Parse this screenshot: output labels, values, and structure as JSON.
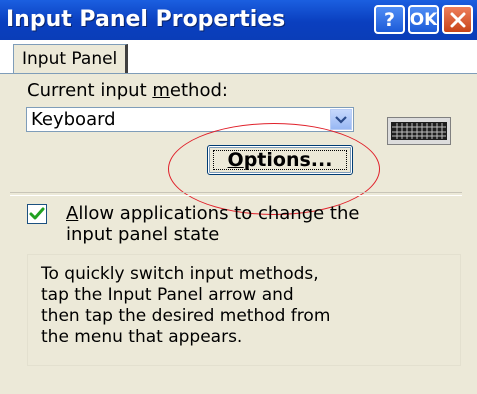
{
  "window": {
    "title": "Input Panel Properties",
    "buttons": {
      "help": "?",
      "ok": "OK",
      "close": "X"
    }
  },
  "tabs": [
    {
      "label": "Input Panel",
      "selected": true
    }
  ],
  "input_method": {
    "label_before": "Current input ",
    "label_accel": "m",
    "label_after": "ethod:",
    "selected_value": "Keyboard",
    "options_label_accel": "O",
    "options_label_rest": "ptions..."
  },
  "allow_apps": {
    "checked": true,
    "label_accel": "A",
    "label_line1_rest": "llow applications to change the",
    "label_line2": "input panel state"
  },
  "info": {
    "lines": [
      "To quickly switch input methods,",
      "tap the Input Panel arrow and",
      "then tap the desired method from",
      "the menu that appears."
    ]
  },
  "colors": {
    "title_bar": "#0a3fbf",
    "annotation_ellipse": "#e0202a",
    "check_mark": "#21a121"
  },
  "icons": {
    "keyboard": "keyboard-icon",
    "dropdown": "chevron-down-icon",
    "check": "checkmark-icon"
  }
}
